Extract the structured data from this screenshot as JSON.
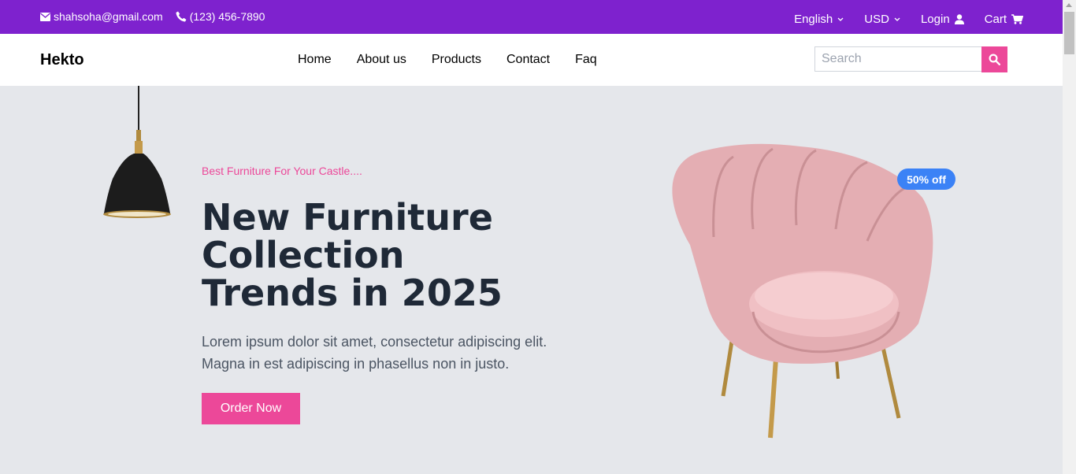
{
  "topbar": {
    "email": "shahsoha@gmail.com",
    "phone": "(123) 456-7890",
    "language": "English",
    "currency": "USD",
    "login": "Login",
    "cart": "Cart"
  },
  "nav": {
    "brand": "Hekto",
    "links": [
      "Home",
      "About us",
      "Products",
      "Contact",
      "Faq"
    ],
    "search_placeholder": "Search"
  },
  "hero": {
    "tagline": "Best Furniture For Your Castle....",
    "headline": [
      "New Furniture",
      "Collection",
      "Trends in 2025"
    ],
    "description": [
      "Lorem ipsum dolor sit amet, consectetur adipiscing elit.",
      "Magna in est adipiscing in phasellus non in justo."
    ],
    "cta": "Order Now",
    "badge": "50% off"
  },
  "colors": {
    "topbar": "#7e22ce",
    "accent": "#ec4899",
    "badge": "#3b82f6",
    "hero_bg": "#e5e7eb",
    "heading": "#1f2937"
  },
  "icons": [
    "envelope-icon",
    "phone-icon",
    "chevron-down-icon",
    "user-icon",
    "cart-icon",
    "search-icon"
  ]
}
